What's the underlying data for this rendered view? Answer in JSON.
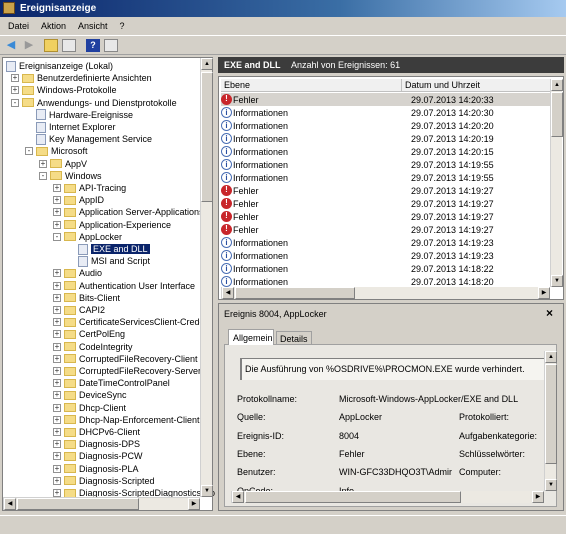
{
  "window": {
    "title": "Ereignisanzeige"
  },
  "menu": [
    "Datei",
    "Aktion",
    "Ansicht",
    "?"
  ],
  "toolbar": {
    "icons": [
      "back-arrow-icon",
      "forward-arrow-icon",
      "folder-up-icon",
      "show-hide-tree-icon",
      "help-icon",
      "show-hide-action-icon"
    ]
  },
  "tree": [
    {
      "label": "Ereignisanzeige (Lokal)",
      "level": 0,
      "type": "root",
      "exp": ""
    },
    {
      "label": "Benutzerdefinierte Ansichten",
      "level": 1,
      "type": "folder",
      "exp": "+"
    },
    {
      "label": "Windows-Protokolle",
      "level": 1,
      "type": "folder",
      "exp": "+"
    },
    {
      "label": "Anwendungs- und Dienstprotokolle",
      "level": 1,
      "type": "folder",
      "exp": "-"
    },
    {
      "label": "Hardware-Ereignisse",
      "level": 2,
      "type": "log",
      "exp": ""
    },
    {
      "label": "Internet Explorer",
      "level": 2,
      "type": "log",
      "exp": ""
    },
    {
      "label": "Key Management Service",
      "level": 2,
      "type": "log",
      "exp": ""
    },
    {
      "label": "Microsoft",
      "level": 2,
      "type": "folder",
      "exp": "-"
    },
    {
      "label": "AppV",
      "level": 3,
      "type": "folder",
      "exp": "+"
    },
    {
      "label": "Windows",
      "level": 3,
      "type": "folder",
      "exp": "-"
    },
    {
      "label": "API-Tracing",
      "level": 4,
      "type": "folder",
      "exp": "+"
    },
    {
      "label": "AppID",
      "level": 4,
      "type": "folder",
      "exp": "+"
    },
    {
      "label": "Application Server-Applications",
      "level": 4,
      "type": "folder",
      "exp": "+"
    },
    {
      "label": "Application-Experience",
      "level": 4,
      "type": "folder",
      "exp": "+"
    },
    {
      "label": "AppLocker",
      "level": 4,
      "type": "folder",
      "exp": "-"
    },
    {
      "label": "EXE and DLL",
      "level": 5,
      "type": "log",
      "exp": "",
      "selected": true
    },
    {
      "label": "MSI and Script",
      "level": 5,
      "type": "log",
      "exp": ""
    },
    {
      "label": "Audio",
      "level": 4,
      "type": "folder",
      "exp": "+"
    },
    {
      "label": "Authentication User Interface",
      "level": 4,
      "type": "folder",
      "exp": "+"
    },
    {
      "label": "Bits-Client",
      "level": 4,
      "type": "folder",
      "exp": "+"
    },
    {
      "label": "CAPI2",
      "level": 4,
      "type": "folder",
      "exp": "+"
    },
    {
      "label": "CertificateServicesClient-Credent",
      "level": 4,
      "type": "folder",
      "exp": "+"
    },
    {
      "label": "CertPolEng",
      "level": 4,
      "type": "folder",
      "exp": "+"
    },
    {
      "label": "CodeIntegrity",
      "level": 4,
      "type": "folder",
      "exp": "+"
    },
    {
      "label": "CorruptedFileRecovery-Client",
      "level": 4,
      "type": "folder",
      "exp": "+"
    },
    {
      "label": "CorruptedFileRecovery-Server",
      "level": 4,
      "type": "folder",
      "exp": "+"
    },
    {
      "label": "DateTimeControlPanel",
      "level": 4,
      "type": "folder",
      "exp": "+"
    },
    {
      "label": "DeviceSync",
      "level": 4,
      "type": "folder",
      "exp": "+"
    },
    {
      "label": "Dhcp-Client",
      "level": 4,
      "type": "folder",
      "exp": "+"
    },
    {
      "label": "Dhcp-Nap-Enforcement-Client",
      "level": 4,
      "type": "folder",
      "exp": "+"
    },
    {
      "label": "DHCPv6-Client",
      "level": 4,
      "type": "folder",
      "exp": "+"
    },
    {
      "label": "Diagnosis-DPS",
      "level": 4,
      "type": "folder",
      "exp": "+"
    },
    {
      "label": "Diagnosis-PCW",
      "level": 4,
      "type": "folder",
      "exp": "+"
    },
    {
      "label": "Diagnosis-PLA",
      "level": 4,
      "type": "folder",
      "exp": "+"
    },
    {
      "label": "Diagnosis-Scripted",
      "level": 4,
      "type": "folder",
      "exp": "+"
    },
    {
      "label": "Diagnosis-ScriptedDiagnosticsPro",
      "level": 4,
      "type": "folder",
      "exp": "+"
    }
  ],
  "events_header": {
    "title": "EXE and DLL",
    "count": "Anzahl von Ereignissen: 61"
  },
  "events": {
    "columns": [
      "Ebene",
      "Datum und Uhrzeit"
    ],
    "rows": [
      {
        "level": "Fehler",
        "date": "29.07.2013 14:20:33",
        "type": "error"
      },
      {
        "level": "Informationen",
        "date": "29.07.2013 14:20:30",
        "type": "info"
      },
      {
        "level": "Informationen",
        "date": "29.07.2013 14:20:20",
        "type": "info"
      },
      {
        "level": "Informationen",
        "date": "29.07.2013 14:20:19",
        "type": "info"
      },
      {
        "level": "Informationen",
        "date": "29.07.2013 14:20:15",
        "type": "info"
      },
      {
        "level": "Informationen",
        "date": "29.07.2013 14:19:55",
        "type": "info"
      },
      {
        "level": "Informationen",
        "date": "29.07.2013 14:19:55",
        "type": "info"
      },
      {
        "level": "Fehler",
        "date": "29.07.2013 14:19:27",
        "type": "error"
      },
      {
        "level": "Fehler",
        "date": "29.07.2013 14:19:27",
        "type": "error"
      },
      {
        "level": "Fehler",
        "date": "29.07.2013 14:19:27",
        "type": "error"
      },
      {
        "level": "Fehler",
        "date": "29.07.2013 14:19:27",
        "type": "error"
      },
      {
        "level": "Informationen",
        "date": "29.07.2013 14:19:23",
        "type": "info"
      },
      {
        "level": "Informationen",
        "date": "29.07.2013 14:19:23",
        "type": "info"
      },
      {
        "level": "Informationen",
        "date": "29.07.2013 14:18:22",
        "type": "info"
      },
      {
        "level": "Informationen",
        "date": "29.07.2013 14:18:20",
        "type": "info"
      }
    ]
  },
  "detail": {
    "title": "Ereignis 8004, AppLocker",
    "close": "×",
    "tabs": [
      "Allgemein",
      "Details"
    ],
    "message": "Die Ausführung von %OSDRIVE%\\PROCMON.EXE wurde verhindert.",
    "fields": [
      {
        "label": "Protokollname:",
        "value": "Microsoft-Windows-AppLocker/EXE and DLL",
        "label2": ""
      },
      {
        "label": "Quelle:",
        "value": "AppLocker",
        "label2": "Protokolliert:"
      },
      {
        "label": "Ereignis-ID:",
        "value": "8004",
        "label2": "Aufgabenkategorie:"
      },
      {
        "label": "Ebene:",
        "value": "Fehler",
        "label2": "Schlüsselwörter:"
      },
      {
        "label": "Benutzer:",
        "value": "WIN-GFC33DHQO3T\\Admir",
        "label2": "Computer:"
      },
      {
        "label": "OpCode:",
        "value": "Info",
        "label2": ""
      }
    ]
  },
  "colors": {
    "title_bar": "#0a246a",
    "selection": "#0a246a",
    "header_bar": "#3c3c3c",
    "error": "#c8262b",
    "info": "#2a4fa0"
  }
}
